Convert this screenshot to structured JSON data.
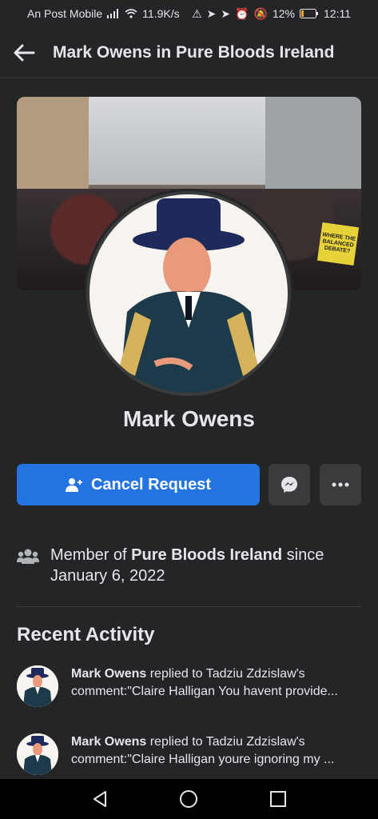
{
  "status": {
    "carrier": "An Post Mobile",
    "speed": "11.9K/s",
    "battery": "12%",
    "time": "12:11"
  },
  "header": {
    "title": "Mark Owens in Pure Bloods Ireland"
  },
  "cover": {
    "sign_text": "WHERE THE BALANCED DEBATE?"
  },
  "profile": {
    "name": "Mark Owens"
  },
  "actions": {
    "cancel_request_label": "Cancel Request",
    "messenger_icon": "messenger-icon",
    "more_icon": "more-icon"
  },
  "membership": {
    "prefix": "Member of ",
    "group": "Pure Bloods Ireland",
    "suffix": " since",
    "date": "January 6, 2022"
  },
  "recent_activity": {
    "title": "Recent Activity",
    "items": [
      {
        "actor": "Mark Owens",
        "action": " replied to Tadziu Zdzislaw's",
        "snippet": "comment:\"Claire Halligan You havent provide..."
      },
      {
        "actor": "Mark Owens",
        "action": " replied to Tadziu Zdzislaw's",
        "snippet": "comment:\"Claire Halligan youre ignoring my ..."
      }
    ]
  },
  "colors": {
    "background": "#242526",
    "primary": "#2374e1",
    "secondary_button": "#3a3b3c",
    "text": "#e4e6eb"
  }
}
